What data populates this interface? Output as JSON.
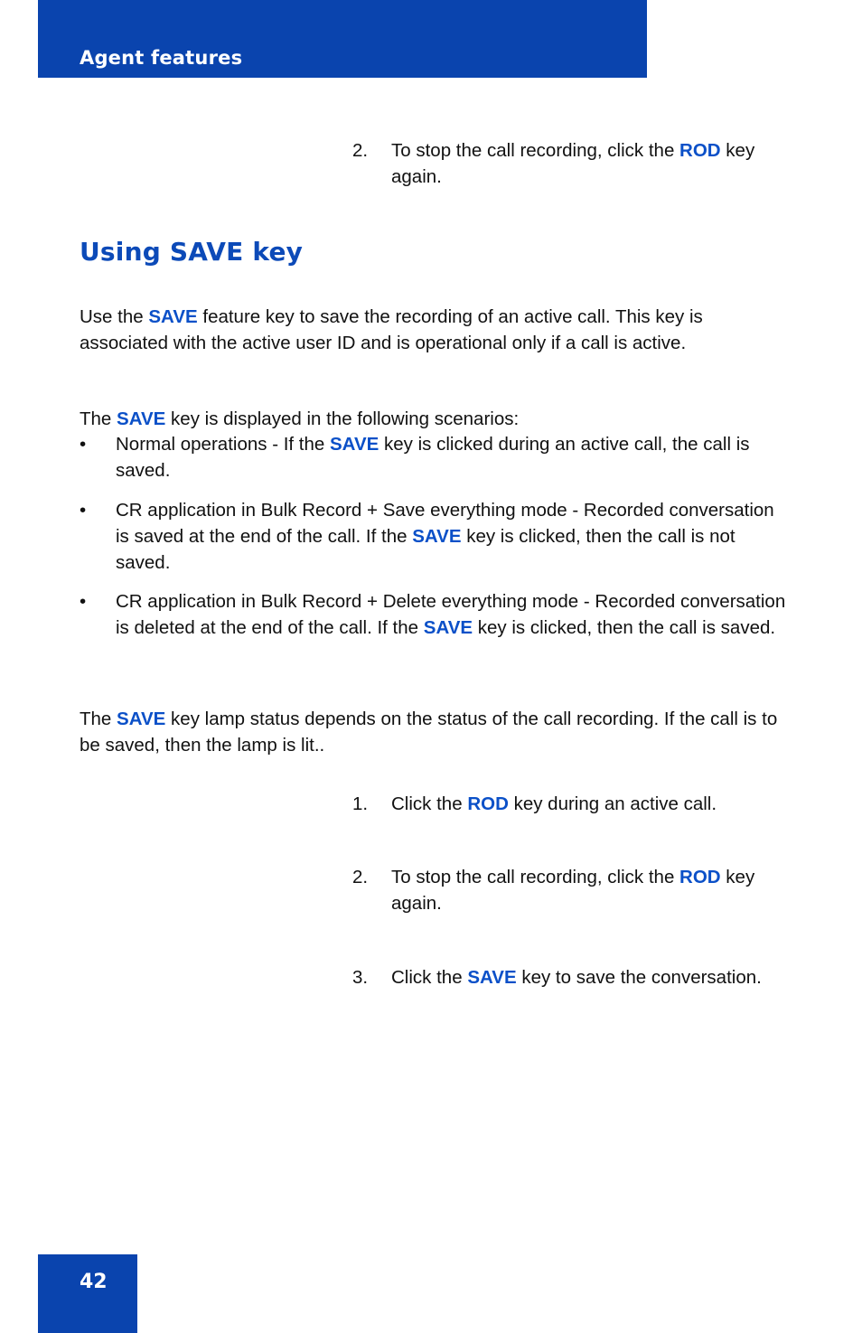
{
  "header": {
    "title": "Agent features",
    "band_color": "#0a44ae"
  },
  "footer": {
    "page_number": "42",
    "block_color": "#0a44ae"
  },
  "theme": {
    "keyword_blue": "#0b50c8",
    "heading_blue": "#0c4ab8",
    "body_black": "#111111"
  },
  "top_step": {
    "number": "2.",
    "text_before": "To stop the call recording, click the ",
    "keyword": "ROD",
    "text_after": " key again."
  },
  "section": {
    "heading": "Using SAVE key",
    "intro_paragraph": {
      "t1": "Use the ",
      "k1": "SAVE",
      "t2": " feature key to save the recording of an active call. This key is associated with the active user ID and is operational only if a call is active."
    },
    "scenarios_lead": {
      "t1": "The ",
      "k1": "SAVE",
      "t2": " key is displayed in the following scenarios:"
    },
    "bullets": [
      {
        "mark": "•",
        "t1": "Normal operations - If the ",
        "k1": "SAVE",
        "t2": " key is clicked during an active call, the call is saved."
      },
      {
        "mark": "•",
        "t1": "CR application in Bulk Record + Save everything mode - Recorded conversation is saved at the end of the call. If the ",
        "k1": "SAVE",
        "t2": " key is clicked, then the call is not saved."
      },
      {
        "mark": "•",
        "t1": "CR application in Bulk Record + Delete everything mode - Recorded conversation is deleted at the end of the call. If the ",
        "k1": "SAVE",
        "t2": " key is clicked, then the call is saved."
      }
    ],
    "lamp_paragraph": {
      "t1": "The ",
      "k1": "SAVE",
      "t2": " key lamp status depends on the status of the call recording. If the call is to be saved, then the lamp is lit.."
    }
  },
  "procedure_steps": [
    {
      "number": "1.",
      "t1": "Click the ",
      "k1": "ROD",
      "t2": " key during an active call."
    },
    {
      "number": "2.",
      "t1": "To stop the call recording, click the ",
      "k1": "ROD",
      "t2": " key again."
    },
    {
      "number": "3.",
      "t1": "Click the ",
      "k1": "SAVE",
      "t2": " key to save the conversation."
    }
  ]
}
